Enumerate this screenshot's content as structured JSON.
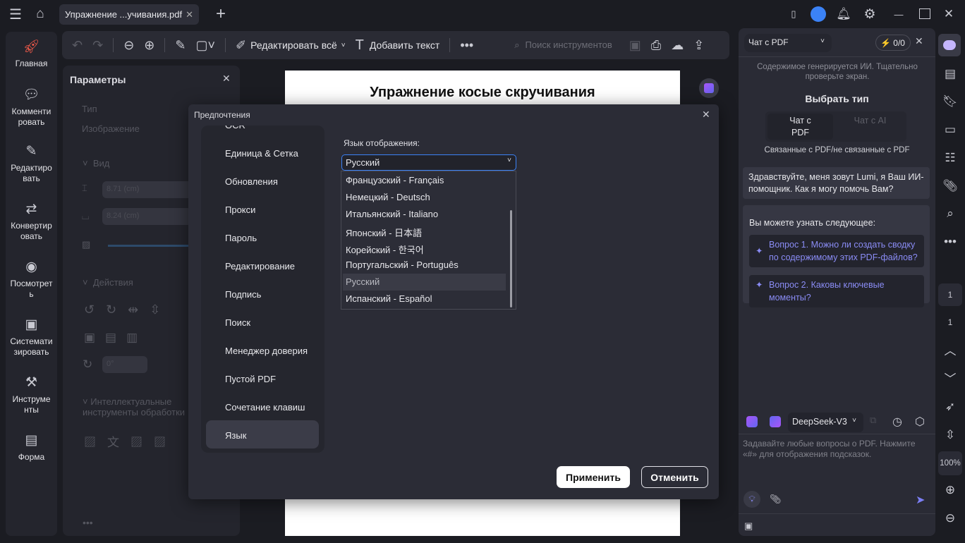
{
  "topbar": {
    "tab_title": "Упражнение ...учивания.pdf"
  },
  "leftnav": [
    {
      "label": "Главная",
      "icon": "rocket-icon"
    },
    {
      "label": "Комменти\nровать",
      "icon": "comment-icon"
    },
    {
      "label": "Редактиро\nвать",
      "icon": "edit-icon"
    },
    {
      "label": "Конвертир\nовать",
      "icon": "convert-icon"
    },
    {
      "label": "Посмотрет\nь",
      "icon": "eye-icon"
    },
    {
      "label": "Системати\nзировать",
      "icon": "organize-icon"
    },
    {
      "label": "Инструме\nнты",
      "icon": "toolbox-icon"
    },
    {
      "label": "Форма",
      "icon": "form-icon"
    }
  ],
  "toolbar": {
    "edit_all": "Редактировать всё",
    "add_text": "Добавить текст",
    "search_placeholder": "Поиск инструментов"
  },
  "params": {
    "title": "Параметры",
    "type_label": "Тип",
    "type_value": "Изображение",
    "view": "Вид",
    "height": "8.71 (cm)",
    "width": "8.24 (cm)",
    "actions": "Действия",
    "rotate": "0°",
    "ai_tools": "Интеллектуальные инструменты обработки"
  },
  "document": {
    "title": "Упражнение косые скручивания"
  },
  "dialog": {
    "title": "Предпочтения",
    "menu": [
      "OCR",
      "Единица & Сетка",
      "Обновления",
      "Прокси",
      "Пароль",
      "Редактирование",
      "Подпись",
      "Поиск",
      "Менеджер доверия",
      "Пустой PDF",
      "Сочетание клавиш",
      "Язык"
    ],
    "lang_label": "Язык отображения:",
    "selected": "Русский",
    "options": [
      "Французский - Français",
      "Немецкий - Deutsch",
      "Итальянский - Italiano",
      "Японский - 日本語",
      "Корейский - 한국어",
      "Португальский - Português",
      "Русский",
      "Испанский - Español"
    ],
    "apply": "Применить",
    "cancel": "Отменить"
  },
  "chat": {
    "mode": "Чат с PDF",
    "credits": "0/0",
    "notice": "Содержимое генерируется ИИ. Тщательно проверьте экран.",
    "choose_type": "Выбрать тип",
    "seg1": "Чат с PDF",
    "seg2": "Чат с AI",
    "seg_caption": "Связанные с PDF/не связанные с PDF",
    "greeting": "Здравствуйте, меня зовут Lumi, я Ваш ИИ-помощник. Как я могу помочь Вам?",
    "learn": "Вы можете узнать следующее:",
    "q1": "Вопрос 1. Можно ли создать сводку по содержимому этих PDF-файлов?",
    "q2": "Вопрос 2. Каковы ключевые моменты?",
    "model": "DeepSeek-V3",
    "input_placeholder": "Задавайте любые вопросы о PDF. Нажмите «#» для отображения подсказок."
  },
  "rail": {
    "page": "1",
    "page_total": "1",
    "zoom": "100%"
  },
  "colors": {
    "accent": "#3b82f6",
    "link": "#8a8cf5"
  }
}
